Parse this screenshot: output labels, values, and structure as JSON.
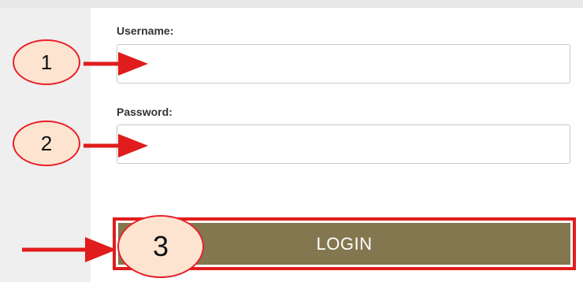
{
  "form": {
    "username_label": "Username:",
    "username_value": "",
    "password_label": "Password:",
    "password_value": "",
    "login_label": "LOGIN"
  },
  "annotations": {
    "markers": [
      "1",
      "2",
      "3"
    ],
    "marker_color": "#e8202a",
    "marker_fill": "#fde4d0",
    "arrow_color": "#e01c1c",
    "arrow_icon": "right-arrow-icon"
  },
  "colors": {
    "login_button": "#83774f",
    "highlight_border": "#e01c1c",
    "page_background": "#eeeeee"
  }
}
